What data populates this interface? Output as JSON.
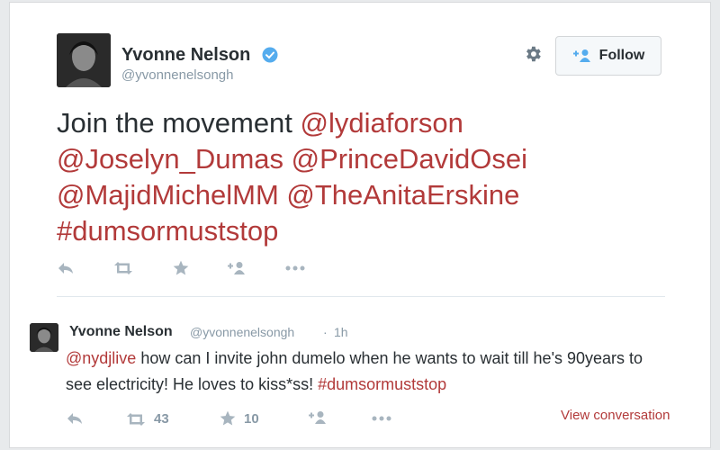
{
  "tweet": {
    "user": {
      "name": "Yvonne Nelson",
      "handle": "@yvonnenelsongh"
    },
    "follow_label": "Follow",
    "text": {
      "prefix": "Join the movement ",
      "m1": "@lydiaforson",
      "m2": "@Joselyn_Dumas",
      "m3": "@PrinceDavidOsei",
      "m4": "@MajidMichelMM",
      "m5": "@TheAnitaErskine",
      "hashtag": "#dumsormuststop"
    }
  },
  "reply": {
    "user": {
      "name": "Yvonne Nelson",
      "handle": "@yvonnenelsongh"
    },
    "separator": "·",
    "time": "1h",
    "text": {
      "mention": "@nydjlive",
      "body": " how can I invite john dumelo when he wants to wait till he's 90years to see electricity! He loves to kiss*ss! ",
      "hashtag": "#dumsormuststop"
    },
    "retweet_count": "43",
    "favorite_count": "10",
    "view_conversation": "View conversation"
  },
  "icons": {
    "verified": "verified-badge-icon",
    "gear": "gear-icon",
    "follow": "add-user-icon",
    "reply": "reply-icon",
    "retweet": "retweet-icon",
    "favorite": "star-icon",
    "more": "more-icon"
  },
  "colors": {
    "link": "#b23a3a",
    "verified": "#55acee",
    "muted": "#8899a6",
    "text": "#292f33"
  }
}
